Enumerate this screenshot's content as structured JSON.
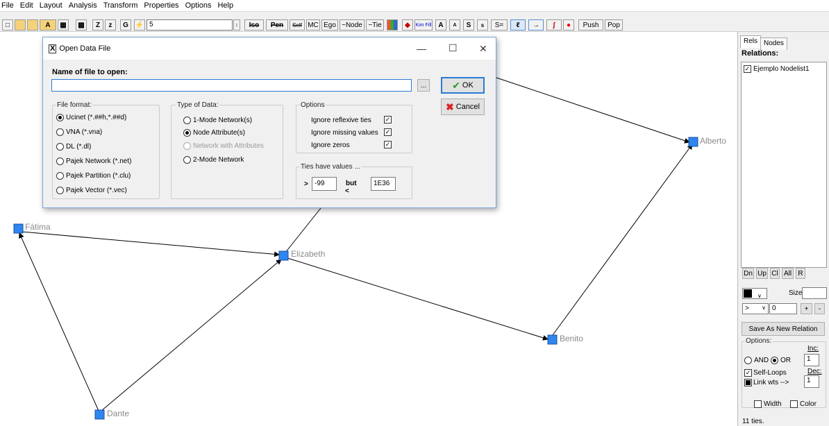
{
  "menu": [
    "File",
    "Edit",
    "Layout",
    "Analysis",
    "Transform",
    "Properties",
    "Options",
    "Help"
  ],
  "toolbar": {
    "z1": "Z",
    "z2": "z",
    "g": "G",
    "spin_value": "5",
    "iso": "Iso",
    "pen": "Pen",
    "self": "Self",
    "mc": "MC",
    "ego": "Ego",
    "node": "~Node",
    "tie": "~Tie",
    "kim": "Kim Fill",
    "a1": "A",
    "a2": "A",
    "s1": "S",
    "s2": "s",
    "seq": "S=",
    "push": "Push",
    "pop": "Pop"
  },
  "dialog": {
    "title": "Open Data File",
    "name_label": "Name of file to open:",
    "browse": "...",
    "ok": "OK",
    "cancel": "Cancel",
    "file_format": {
      "legend": "File format:",
      "options": [
        "Ucinet (*.##h,*.##d)",
        "VNA (*.vna)",
        "DL (*.dl)",
        "Pajek Network (*.net)",
        "Pajek Partition (*.clu)",
        "Pajek Vector (*.vec)"
      ]
    },
    "type_of_data": {
      "legend": "Type of Data:",
      "options": [
        "1-Mode Network(s)",
        "Node Attribute(s)",
        "Network with Attributes",
        "2-Mode Network"
      ]
    },
    "options": {
      "legend": "Options",
      "items": [
        "Ignore reflexive ties",
        "Ignore missing values",
        "Ignore zeros"
      ]
    },
    "ties": {
      "legend": "Ties have values ...",
      "gt": ">",
      "value1": "-99",
      "but": "but",
      "lt": "<",
      "value2": "1E36"
    }
  },
  "network": {
    "nodes": [
      "Alberto",
      "Fátima",
      "Elizabeth",
      "Benito",
      "Dante"
    ]
  },
  "right_panel": {
    "tabs": [
      "Rels",
      "Nodes"
    ],
    "relations_label": "Relations:",
    "relation_item": "Ejemplo Nodelist1",
    "btns": [
      "Dn",
      "Up",
      "Cl",
      "All",
      "R"
    ],
    "size_label": "Size:",
    "op_value": ">",
    "num_value": "0",
    "plus": "+",
    "minus": "-",
    "save_btn": "Save As New Relation",
    "options_legend": "Options:",
    "and": "AND",
    "or": "OR",
    "inc_label": "Inc:",
    "inc_value": "1",
    "self_loops": "Self-Loops",
    "dec_label": "Dec:",
    "dec_value": "1",
    "link_wts": "Link wts -->",
    "width": "Width",
    "color": "Color",
    "status": "11 ties."
  }
}
